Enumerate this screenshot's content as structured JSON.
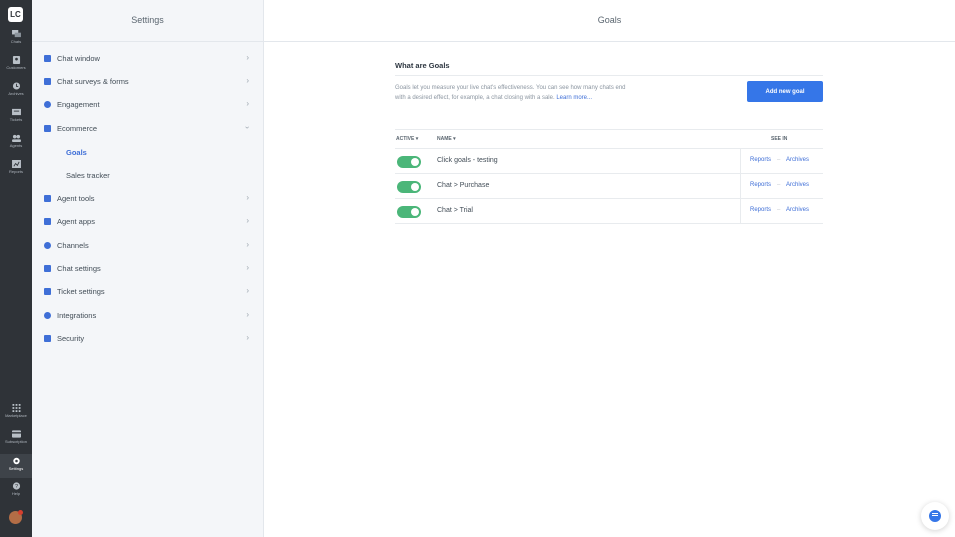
{
  "rail": {
    "logo": "LC",
    "items": [
      {
        "label": "Chats",
        "icon": "chat-icon"
      },
      {
        "label": "Customers",
        "icon": "customers-icon"
      },
      {
        "label": "Archives",
        "icon": "archives-icon"
      },
      {
        "label": "Tickets",
        "icon": "tickets-icon"
      },
      {
        "label": "Agents",
        "icon": "agents-icon"
      },
      {
        "label": "Reports",
        "icon": "reports-icon"
      }
    ],
    "bottom_items": [
      {
        "label": "Marketplace",
        "icon": "grid-icon"
      },
      {
        "label": "Subscription",
        "icon": "card-icon"
      },
      {
        "label": "Settings",
        "icon": "gear-icon"
      },
      {
        "label": "Help",
        "icon": "help-icon"
      }
    ]
  },
  "sidebar": {
    "title": "Settings",
    "items": [
      {
        "label": "Chat window"
      },
      {
        "label": "Chat surveys & forms"
      },
      {
        "label": "Engagement"
      },
      {
        "label": "Ecommerce"
      },
      {
        "label": "Agent tools"
      },
      {
        "label": "Agent apps"
      },
      {
        "label": "Channels"
      },
      {
        "label": "Chat settings"
      },
      {
        "label": "Ticket settings"
      },
      {
        "label": "Integrations"
      },
      {
        "label": "Security"
      }
    ],
    "sub_items": [
      {
        "label": "Goals"
      },
      {
        "label": "Sales tracker"
      }
    ]
  },
  "main": {
    "title": "Goals",
    "section_title": "What are Goals",
    "description": "Goals let you measure your live chat's effectiveness. You can see how many chats end with a desired effect, for example, a chat closing with a sale.",
    "learn_more": "Learn more...",
    "add_button": "Add new goal",
    "table": {
      "col_active": "ACTIVE ▾",
      "col_name": "NAME ▾",
      "col_see_in": "SEE IN",
      "rows": [
        {
          "name": "Click goals - testing",
          "active": true,
          "reports": "Reports",
          "archives": "Archives"
        },
        {
          "name": "Chat > Purchase",
          "active": true,
          "reports": "Reports",
          "archives": "Archives"
        },
        {
          "name": "Chat > Trial",
          "active": true,
          "reports": "Reports",
          "archives": "Archives"
        }
      ]
    }
  },
  "colors": {
    "rail": "#2f3338",
    "sidebar": "#f4f6f9",
    "accent": "#3576e8",
    "toggle_on": "#4bb679"
  }
}
